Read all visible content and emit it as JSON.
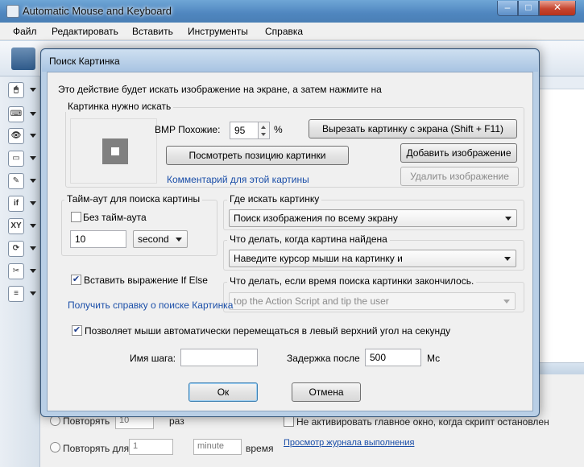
{
  "app": {
    "title": "Automatic Mouse and Keyboard",
    "menu": [
      "Файл",
      "Редактировать",
      "Вставить",
      "Инструменты",
      "Справка"
    ],
    "window_controls": {
      "minimize": "‒",
      "maximize": "□",
      "close": "✕"
    }
  },
  "left_rail": [
    {
      "icon": "mouse-icon",
      "glyph": "🖱"
    },
    {
      "icon": "keyboard-icon",
      "glyph": "⌨"
    },
    {
      "icon": "eye-icon",
      "glyph": "👁"
    },
    {
      "icon": "window-icon",
      "glyph": "▭"
    },
    {
      "icon": "folder-icon",
      "glyph": "✎"
    },
    {
      "icon": "if-icon",
      "glyph": "if"
    },
    {
      "icon": "xy-icon",
      "glyph": "XY"
    },
    {
      "icon": "loop-icon",
      "glyph": "⟳"
    },
    {
      "icon": "tools-icon",
      "glyph": "✂"
    },
    {
      "icon": "list-icon",
      "glyph": "≡"
    }
  ],
  "background": {
    "repeat_label": "Повторять",
    "repeat_value": "10",
    "repeat_unit": "раз",
    "repeat_for_label": "Повторять для",
    "repeat_for_value": "1",
    "repeat_for_unit": "minute",
    "time_label": "время",
    "no_activate_label": "Не активировать главное окно, когда скрипт остановлен",
    "log_link": "Просмотр журнала выполнения"
  },
  "dialog": {
    "title": "Поиск Картинка",
    "intro": "Это действие будет искать изображение на экране, а затем нажмите на",
    "image_group": {
      "legend": "Картинка нужно искать",
      "similarity_label": "BMP Похожие:",
      "similarity_value": "95",
      "similarity_unit": "%",
      "cut_button": "Вырезать картинку с экрана (Shift + F11)",
      "view_position_button": "Посмотреть позицию картинки",
      "add_image_button": "Добавить изображение",
      "remove_image_button": "Удалить изображение",
      "comment_link": "Комментарий для этой картины"
    },
    "timeout_group": {
      "legend": "Тайм-аут для поиска картины",
      "no_timeout_label": "Без тайм-аута",
      "no_timeout_checked": false,
      "timeout_value": "10",
      "timeout_unit": "second"
    },
    "where_group": {
      "legend": "Где искать картинку",
      "value": "Поиск изображения по всему экрану"
    },
    "found_group": {
      "legend": "Что делать, когда картина найдена",
      "value": "Наведите курсор мыши на картинку и"
    },
    "timeout_action_group": {
      "legend": "Что делать, если время поиска картинки закончилось.",
      "value": "top the Action Script and tip the user"
    },
    "insert_if_label": "Вставить выражение If Else",
    "insert_if_checked": true,
    "help_link": "Получить справку о поиске Картинка",
    "auto_move_label": "Позволяет мыши автоматически перемещаться в левый верхний угол на секунду",
    "auto_move_checked": true,
    "step_name_label": "Имя шага:",
    "step_name_value": "",
    "delay_label": "Задержка после",
    "delay_value": "500",
    "delay_unit": "Мс",
    "ok_button": "Ок",
    "cancel_button": "Отмена"
  }
}
